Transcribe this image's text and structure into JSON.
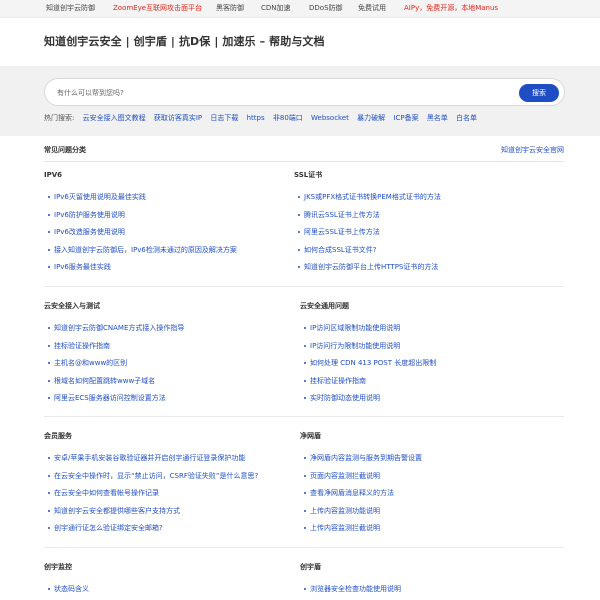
{
  "topnav": [
    {
      "label": "知道创宇云防御",
      "red": false
    },
    {
      "label": "ZoomEye互联网攻击面平台",
      "red": true
    },
    {
      "label": "黑客防御",
      "red": false
    },
    {
      "label": "CDN加速",
      "red": false
    },
    {
      "label": "DDoS防御",
      "red": false
    },
    {
      "label": "免费试用",
      "red": false
    },
    {
      "label": "AIPy，免费开源，本地Manus",
      "red": true
    }
  ],
  "site_title": "知道创宇云安全 | 创宇盾 | 抗D保 | 加速乐 – 帮助与文档",
  "search": {
    "placeholder": "有什么可以帮到您吗?",
    "button_label": "搜索",
    "hot_label": "热门搜索:",
    "hot_items": [
      "云安全接入图文教程",
      "获取访客真实IP",
      "日志下载",
      "https",
      "非80端口",
      "Websocket",
      "暴力破解",
      "ICP备案",
      "黑名单",
      "白名单"
    ]
  },
  "faq": {
    "title": "常见问题分类",
    "official_link": "知道创宇云安全官网"
  },
  "sections": [
    {
      "title": "IPV6",
      "items": [
        "IPv6灭留使用说明及最佳实践",
        "IPv6防护服务使用说明",
        "IPv6改造服务使用说明",
        "接入知道创宇云防御后，IPv6检测未通过的原因及解决方案",
        "IPv6服务最佳实践"
      ]
    },
    {
      "title": "SSL证书",
      "items": [
        "JKS或PFX格式证书转换PEM格式证书的方法",
        "腾讯云SSL证书上传方法",
        "阿里云SSL证书上传方法",
        "如何合成SSL证书文件?",
        "知道创宇云防御平台上传HTTPS证书的方法"
      ]
    },
    {
      "title": "云安全接入与测试",
      "items": [
        "知道创宇云防御CNAME方式接入操作指导",
        "挂标验证操作指南",
        "主机名@和www的区别",
        "根域名如何配置跳转www子域名",
        "阿里云ECS服务器访问控制设置方法"
      ]
    },
    {
      "title": "云安全通用问题",
      "items": [
        "IP访问区域限制功能使用说明",
        "IP访问行为限制功能使用说明",
        "如何处理 CDN 413 POST 长度超出限制",
        "挂标验证操作指南",
        "实时防御动态使用说明"
      ]
    },
    {
      "title": "会员服务",
      "items": [
        "安卓/苹果手机安装谷歌验证器并开启创宇通行证登录保护功能",
        "在云安全中操作时，显示“禁止访问，CSRF验证失败”是什么意思?",
        "在云安全中如何查看帐号操作记录",
        "知道创宇云安全都提供哪些客户支持方式",
        "创宇通行证怎么验证绑定安全邮箱?"
      ]
    },
    {
      "title": "净网盾",
      "items": [
        "净网盾内容监测与服务到期告警设置",
        "页面内容监测拦截说明",
        "查看净网盾消息释义的方法",
        "上传内容监测功能说明",
        "上传内容监测拦截说明"
      ]
    },
    {
      "title": "创宇监控",
      "items": [
        "状态码含义"
      ]
    },
    {
      "title": "创宇盾",
      "items": [
        "浏览器安全检查功能使用说明"
      ]
    }
  ]
}
